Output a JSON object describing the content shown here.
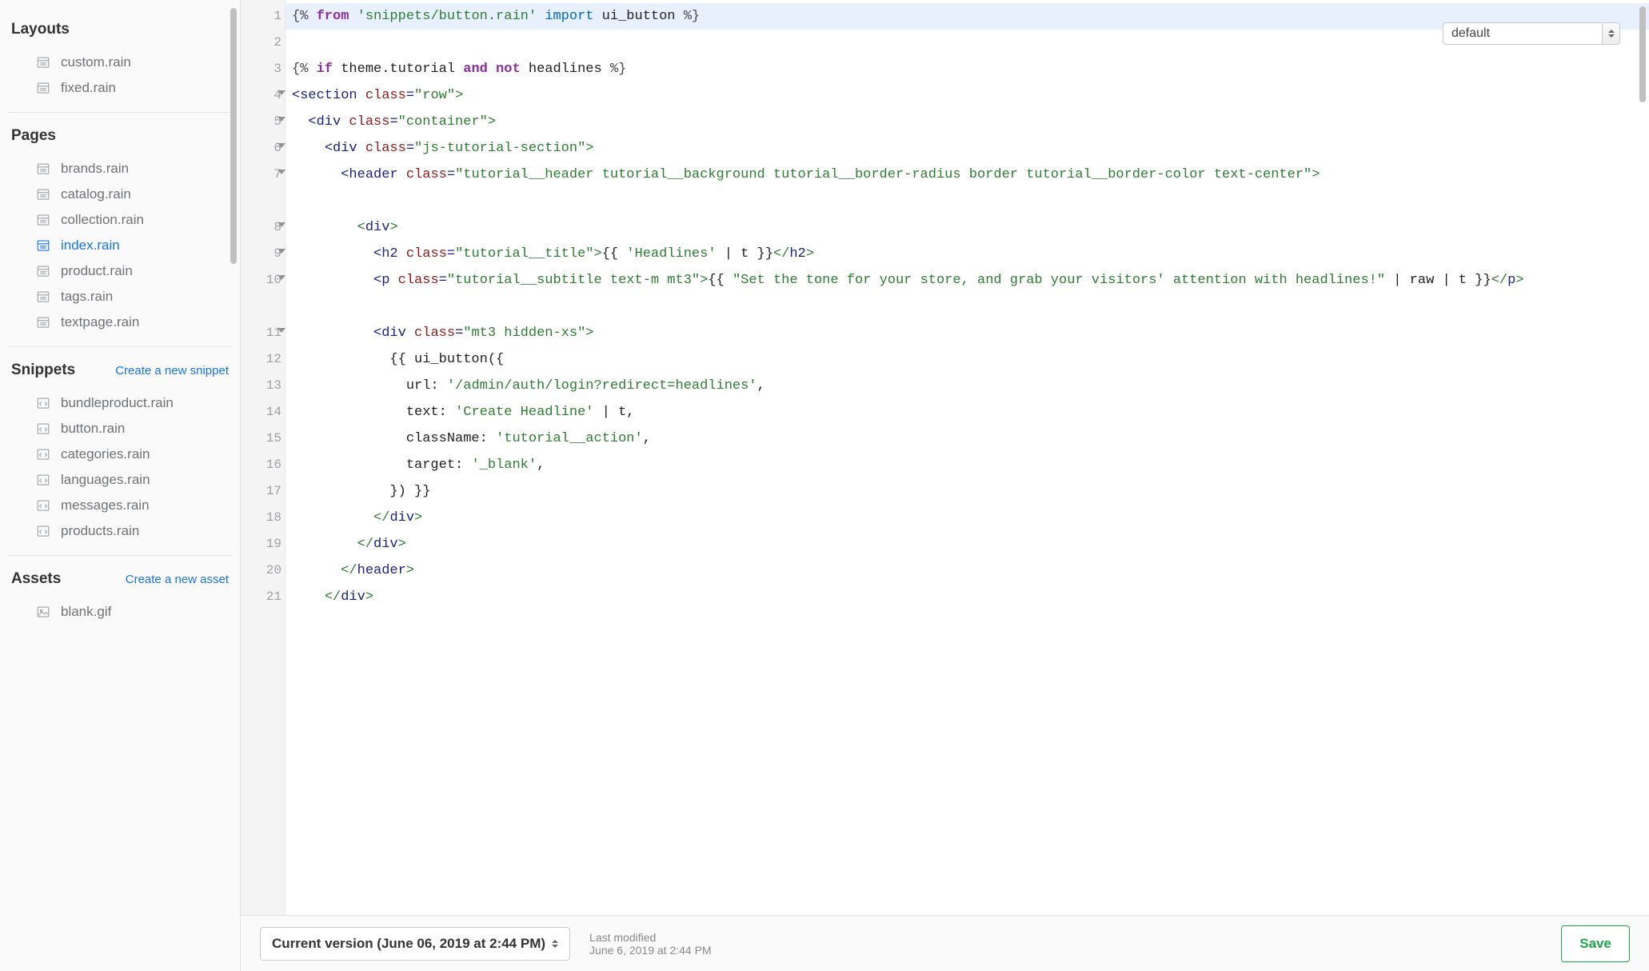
{
  "sidebar": {
    "sections": {
      "layouts": {
        "title": "Layouts",
        "items": [
          "custom.rain",
          "fixed.rain"
        ]
      },
      "pages": {
        "title": "Pages",
        "items": [
          "brands.rain",
          "catalog.rain",
          "collection.rain",
          "index.rain",
          "product.rain",
          "tags.rain",
          "textpage.rain"
        ],
        "active": "index.rain"
      },
      "snippets": {
        "title": "Snippets",
        "create": "Create a new snippet",
        "items": [
          "bundleproduct.rain",
          "button.rain",
          "categories.rain",
          "languages.rain",
          "messages.rain",
          "products.rain"
        ]
      },
      "assets": {
        "title": "Assets",
        "create": "Create a new asset",
        "items": [
          "blank.gif"
        ]
      }
    }
  },
  "dropdown": {
    "value": "default"
  },
  "editor": {
    "lines": [
      {
        "n": 1,
        "fold": false,
        "hl": true,
        "tokens": [
          [
            "t-delim",
            "{% "
          ],
          [
            "t-key",
            "from"
          ],
          [
            "t-plain",
            " "
          ],
          [
            "t-str",
            "'snippets/button.rain'"
          ],
          [
            "t-plain",
            " "
          ],
          [
            "t-import",
            "import"
          ],
          [
            "t-plain",
            " ui_button "
          ],
          [
            "t-delim",
            "%}"
          ]
        ]
      },
      {
        "n": 2,
        "fold": false,
        "tokens": []
      },
      {
        "n": 3,
        "fold": false,
        "tokens": [
          [
            "t-delim",
            "{% "
          ],
          [
            "t-key",
            "if"
          ],
          [
            "t-plain",
            " theme.tutorial "
          ],
          [
            "t-key",
            "and not"
          ],
          [
            "t-plain",
            " headlines "
          ],
          [
            "t-delim",
            "%}"
          ]
        ]
      },
      {
        "n": 4,
        "fold": true,
        "tokens": [
          [
            "t-brack-n",
            "<"
          ],
          [
            "t-tag",
            "section"
          ],
          [
            "t-plain",
            " "
          ],
          [
            "t-attr",
            "class"
          ],
          [
            "t-brack-n",
            "="
          ],
          [
            "t-val",
            "\"row\""
          ],
          [
            "t-brack-g",
            ">"
          ]
        ]
      },
      {
        "n": 5,
        "fold": true,
        "tokens": [
          [
            "t-plain",
            "  "
          ],
          [
            "t-brack-n",
            "<"
          ],
          [
            "t-tag",
            "div"
          ],
          [
            "t-plain",
            " "
          ],
          [
            "t-attr",
            "class"
          ],
          [
            "t-brack-n",
            "="
          ],
          [
            "t-val",
            "\"container\""
          ],
          [
            "t-brack-g",
            ">"
          ]
        ]
      },
      {
        "n": 6,
        "fold": true,
        "tokens": [
          [
            "t-plain",
            "    "
          ],
          [
            "t-brack-n",
            "<"
          ],
          [
            "t-tag",
            "div"
          ],
          [
            "t-plain",
            " "
          ],
          [
            "t-attr",
            "class"
          ],
          [
            "t-brack-n",
            "="
          ],
          [
            "t-val",
            "\"js-tutorial-section\""
          ],
          [
            "t-brack-g",
            ">"
          ]
        ]
      },
      {
        "n": 7,
        "fold": true,
        "wrap": true,
        "tokens": [
          [
            "t-plain",
            "      "
          ],
          [
            "t-brack-n",
            "<"
          ],
          [
            "t-tag",
            "header"
          ],
          [
            "t-plain",
            " "
          ],
          [
            "t-attr",
            "class"
          ],
          [
            "t-brack-n",
            "="
          ],
          [
            "t-val",
            "\"tutorial__header tutorial__background tutorial__border-radius border tutorial__border-color text-center\""
          ],
          [
            "t-brack-g",
            ">"
          ]
        ]
      },
      {
        "n": 8,
        "fold": true,
        "tokens": [
          [
            "t-plain",
            "        "
          ],
          [
            "t-brack-g",
            "<"
          ],
          [
            "t-tag",
            "div"
          ],
          [
            "t-brack-g",
            ">"
          ]
        ]
      },
      {
        "n": 9,
        "fold": true,
        "tokens": [
          [
            "t-plain",
            "          "
          ],
          [
            "t-brack-n",
            "<"
          ],
          [
            "t-tag",
            "h2"
          ],
          [
            "t-plain",
            " "
          ],
          [
            "t-attr",
            "class"
          ],
          [
            "t-brack-n",
            "="
          ],
          [
            "t-val",
            "\"tutorial__title\""
          ],
          [
            "t-brack-g",
            ">"
          ],
          [
            "t-plain",
            "{{ "
          ],
          [
            "t-str",
            "'Headlines'"
          ],
          [
            "t-plain",
            " | t }}"
          ],
          [
            "t-brack-g",
            "</"
          ],
          [
            "t-tag",
            "h2"
          ],
          [
            "t-brack-g",
            ">"
          ]
        ]
      },
      {
        "n": 10,
        "fold": true,
        "wrap": true,
        "tokens": [
          [
            "t-plain",
            "          "
          ],
          [
            "t-brack-n",
            "<"
          ],
          [
            "t-tag",
            "p"
          ],
          [
            "t-plain",
            " "
          ],
          [
            "t-attr",
            "class"
          ],
          [
            "t-brack-n",
            "="
          ],
          [
            "t-val",
            "\"tutorial__subtitle text-m mt3\""
          ],
          [
            "t-brack-g",
            ">"
          ],
          [
            "t-plain",
            "{{ "
          ],
          [
            "t-str",
            "\"Set the tone for your store, and grab your visitors' attention with headlines!\""
          ],
          [
            "t-plain",
            " | raw | t }}"
          ],
          [
            "t-brack-g",
            "</"
          ],
          [
            "t-tag",
            "p"
          ],
          [
            "t-brack-g",
            ">"
          ]
        ]
      },
      {
        "n": 11,
        "fold": true,
        "tokens": [
          [
            "t-plain",
            "          "
          ],
          [
            "t-brack-n",
            "<"
          ],
          [
            "t-tag",
            "div"
          ],
          [
            "t-plain",
            " "
          ],
          [
            "t-attr",
            "class"
          ],
          [
            "t-brack-n",
            "="
          ],
          [
            "t-val",
            "\"mt3 hidden-xs\""
          ],
          [
            "t-brack-g",
            ">"
          ]
        ]
      },
      {
        "n": 12,
        "fold": false,
        "tokens": [
          [
            "t-plain",
            "            {{ ui_button({"
          ]
        ]
      },
      {
        "n": 13,
        "fold": false,
        "tokens": [
          [
            "t-plain",
            "              url: "
          ],
          [
            "t-str",
            "'/admin/auth/login?redirect=headlines'"
          ],
          [
            "t-plain",
            ","
          ]
        ]
      },
      {
        "n": 14,
        "fold": false,
        "tokens": [
          [
            "t-plain",
            "              text: "
          ],
          [
            "t-str",
            "'Create Headline'"
          ],
          [
            "t-plain",
            " | t,"
          ]
        ]
      },
      {
        "n": 15,
        "fold": false,
        "tokens": [
          [
            "t-plain",
            "              className: "
          ],
          [
            "t-str",
            "'tutorial__action'"
          ],
          [
            "t-plain",
            ","
          ]
        ]
      },
      {
        "n": 16,
        "fold": false,
        "tokens": [
          [
            "t-plain",
            "              target: "
          ],
          [
            "t-str",
            "'_blank'"
          ],
          [
            "t-plain",
            ","
          ]
        ]
      },
      {
        "n": 17,
        "fold": false,
        "tokens": [
          [
            "t-plain",
            "            }) }}"
          ]
        ]
      },
      {
        "n": 18,
        "fold": false,
        "tokens": [
          [
            "t-plain",
            "          "
          ],
          [
            "t-brack-g",
            "</"
          ],
          [
            "t-tag",
            "div"
          ],
          [
            "t-brack-g",
            ">"
          ]
        ]
      },
      {
        "n": 19,
        "fold": false,
        "tokens": [
          [
            "t-plain",
            "        "
          ],
          [
            "t-brack-g",
            "</"
          ],
          [
            "t-tag",
            "div"
          ],
          [
            "t-brack-g",
            ">"
          ]
        ]
      },
      {
        "n": 20,
        "fold": false,
        "tokens": [
          [
            "t-plain",
            "      "
          ],
          [
            "t-brack-g",
            "</"
          ],
          [
            "t-tag",
            "header"
          ],
          [
            "t-brack-g",
            ">"
          ]
        ]
      },
      {
        "n": 21,
        "fold": false,
        "tokens": [
          [
            "t-plain",
            "    "
          ],
          [
            "t-brack-g",
            "</"
          ],
          [
            "t-tag",
            "div"
          ],
          [
            "t-brack-g",
            ">"
          ]
        ]
      }
    ]
  },
  "footer": {
    "version": "Current version (June 06, 2019 at 2:44 PM)",
    "meta_label": "Last modified",
    "meta_value": "June 6, 2019 at 2:44 PM",
    "save": "Save"
  }
}
